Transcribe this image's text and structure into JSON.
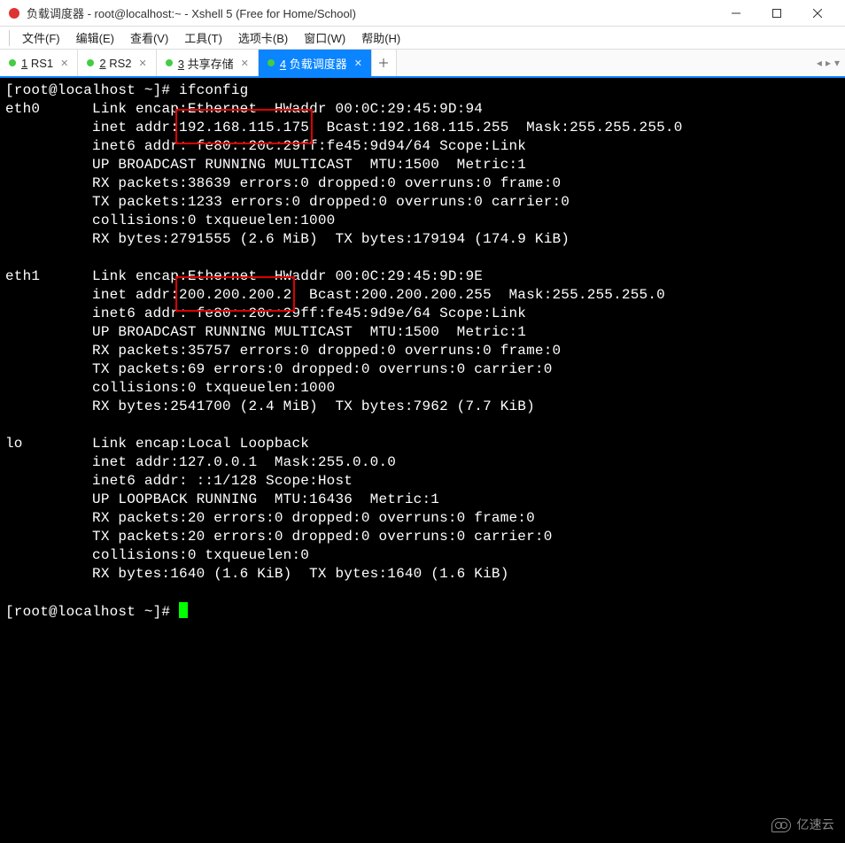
{
  "window": {
    "title": "负载调度器 - root@localhost:~ - Xshell 5 (Free for Home/School)"
  },
  "menu": {
    "file": "文件(F)",
    "edit": "编辑(E)",
    "view": "查看(V)",
    "tools": "工具(T)",
    "tabs": "选项卡(B)",
    "window": "窗口(W)",
    "help": "帮助(H)"
  },
  "tabs": [
    {
      "num": "1",
      "label": "RS1",
      "active": false
    },
    {
      "num": "2",
      "label": "RS2",
      "active": false
    },
    {
      "num": "3",
      "label": "共享存储",
      "active": false
    },
    {
      "num": "4",
      "label": "负载调度器",
      "active": true
    }
  ],
  "terminal": {
    "prompt1": "[root@localhost ~]# ",
    "cmd1": "ifconfig",
    "eth0": {
      "name": "eth0",
      "l1a": "Link encap:Ethernet  HWaddr 00:0C:29:45:9D:94",
      "l2a": "inet addr:",
      "l2_ip": "192.168.115.175",
      "l2b": "  Bcast:192.168.115.255  Mask:255.255.255.0",
      "l3": "inet6 addr: fe80::20c:29ff:fe45:9d94/64 Scope:Link",
      "l4": "UP BROADCAST RUNNING MULTICAST  MTU:1500  Metric:1",
      "l5": "RX packets:38639 errors:0 dropped:0 overruns:0 frame:0",
      "l6": "TX packets:1233 errors:0 dropped:0 overruns:0 carrier:0",
      "l7": "collisions:0 txqueuelen:1000",
      "l8": "RX bytes:2791555 (2.6 MiB)  TX bytes:179194 (174.9 KiB)"
    },
    "eth1": {
      "name": "eth1",
      "l1a": "Link encap:Ethernet  HWaddr 00:0C:29:45:9D:9E",
      "l2a": "inet addr:",
      "l2_ip": "200.200.200.2",
      "l2b": "  Bcast:200.200.200.255  Mask:255.255.255.0",
      "l3": "inet6 addr: fe80::20c:29ff:fe45:9d9e/64 Scope:Link",
      "l4": "UP BROADCAST RUNNING MULTICAST  MTU:1500  Metric:1",
      "l5": "RX packets:35757 errors:0 dropped:0 overruns:0 frame:0",
      "l6": "TX packets:69 errors:0 dropped:0 overruns:0 carrier:0",
      "l7": "collisions:0 txqueuelen:1000",
      "l8": "RX bytes:2541700 (2.4 MiB)  TX bytes:7962 (7.7 KiB)"
    },
    "lo": {
      "name": "lo",
      "l1": "Link encap:Local Loopback",
      "l2": "inet addr:127.0.0.1  Mask:255.0.0.0",
      "l3": "inet6 addr: ::1/128 Scope:Host",
      "l4": "UP LOOPBACK RUNNING  MTU:16436  Metric:1",
      "l5": "RX packets:20 errors:0 dropped:0 overruns:0 frame:0",
      "l6": "TX packets:20 errors:0 dropped:0 overruns:0 carrier:0",
      "l7": "collisions:0 txqueuelen:0",
      "l8": "RX bytes:1640 (1.6 KiB)  TX bytes:1640 (1.6 KiB)"
    },
    "prompt2": "[root@localhost ~]# "
  },
  "watermark": "亿速云",
  "highlights": [
    {
      "ip": "192.168.115.175",
      "interface": "eth0"
    },
    {
      "ip": "200.200.200.2",
      "interface": "eth1"
    }
  ]
}
